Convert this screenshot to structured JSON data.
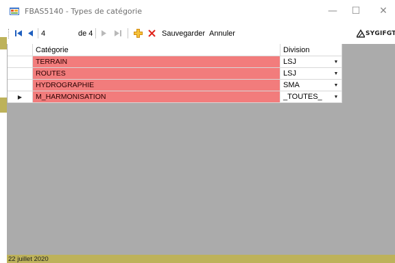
{
  "window": {
    "title": "FBAS5140 - Types de catégorie",
    "minimize_glyph": "—",
    "maximize_glyph": "☐",
    "close_glyph": "✕"
  },
  "toolbar": {
    "first_icon": "move-first-icon",
    "prev_icon": "move-previous-icon",
    "position_value": "4",
    "count_label": "de 4",
    "next_icon": "move-next-icon",
    "last_icon": "move-last-icon",
    "add_icon": "add-new-icon",
    "delete_icon": "delete-icon",
    "save_label": "Sauvegarder",
    "cancel_label": "Annuler",
    "logo_text": "SYGIFGT"
  },
  "grid": {
    "columns": [
      "Catégorie",
      "Division"
    ],
    "rows": [
      {
        "category": "TERRAIN",
        "division": "LSJ",
        "current": false
      },
      {
        "category": "ROUTES",
        "division": "LSJ",
        "current": false
      },
      {
        "category": "HYDROGRAPHIE",
        "division": "SMA",
        "current": false
      },
      {
        "category": "M_HARMONISATION",
        "division": "_TOUTES_",
        "current": true
      }
    ],
    "current_row_marker": "▶",
    "dropdown_glyph": "▼",
    "category_cell_color": "#f27c7c"
  },
  "status": {
    "date": "22 juillet 2020",
    "bar_color": "#bdb25a"
  }
}
